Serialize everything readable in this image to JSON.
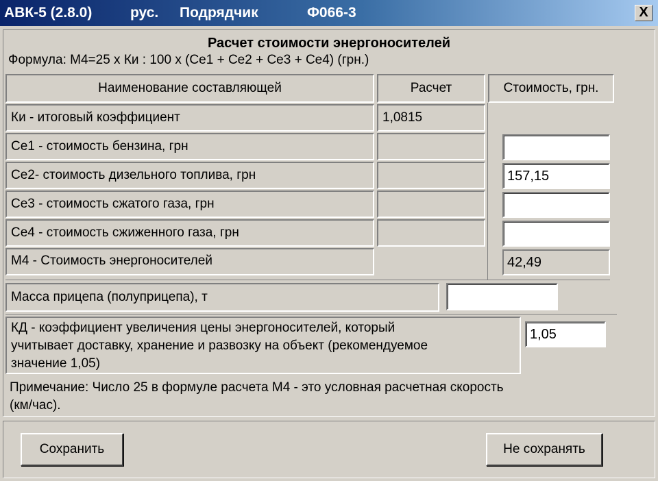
{
  "window": {
    "title_app": "АВК-5 (2.8.0)",
    "title_lang": "рус.",
    "title_user": "Подрядчик",
    "title_form": "Ф066-3",
    "close_label": "X"
  },
  "form": {
    "heading": "Расчет стоимости энергоносителей",
    "formula": "Формула: М4=25 х Ки : 100 х (Се1 + Се2 + Се3 + Се4) (грн.)"
  },
  "table": {
    "col_name": "Наименование составляющей",
    "col_calc": "Расчет",
    "col_cost": "Стоимость, грн.",
    "rows": [
      {
        "label": "Ки - итоговый коэффициент",
        "calc": "1,0815",
        "cost": ""
      },
      {
        "label": "Се1 - стоимость бензина, грн",
        "calc": "",
        "cost": ""
      },
      {
        "label": "Се2- стоимость дизельного топлива, грн",
        "calc": "",
        "cost": "157,15"
      },
      {
        "label": "Се3 - стоимость сжатого газа, грн",
        "calc": "",
        "cost": ""
      },
      {
        "label": "Се4 - стоимость сжиженного газа, грн",
        "calc": "",
        "cost": ""
      },
      {
        "label": "М4 - Стоимость энергоносителей",
        "calc": "",
        "cost": "42,49"
      }
    ]
  },
  "trailer": {
    "label": "Масса прицепа (полуприцепа), т",
    "value": ""
  },
  "kd": {
    "line1": "КД - коэффициент увеличения цены энергоносителей, который",
    "line2": "учитывает доставку, хранение и развозку на объект (рекомендуемое",
    "line3": "значение 1,05)",
    "value": "1,05"
  },
  "note": {
    "line1": "Примечание: Число 25 в формуле расчета М4 - это условная расчетная скорость",
    "line2": "(км/час)."
  },
  "buttons": {
    "save": "Сохранить",
    "nosave": "Не сохранять"
  },
  "colors": {
    "titlebar_start": "#0a246a",
    "titlebar_end": "#a6caf0",
    "face": "#d4d0c8"
  }
}
